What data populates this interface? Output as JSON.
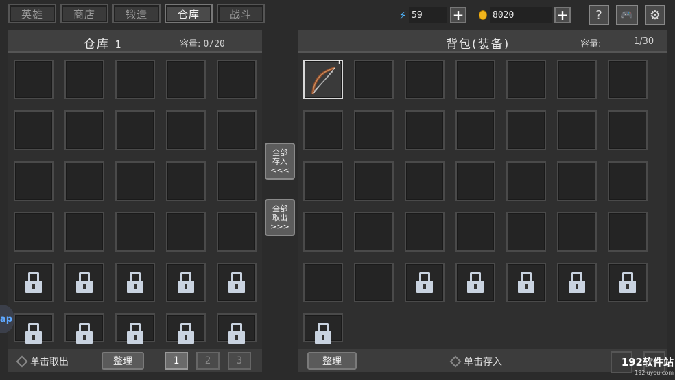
{
  "tabs": [
    "英雄",
    "商店",
    "锻造",
    "仓库",
    "战斗"
  ],
  "active_tab": 3,
  "resources": {
    "energy": "59",
    "gold": "8020"
  },
  "colors": {
    "energy": "#4fb6ff",
    "gold": "#f2b51c",
    "lock": "#c9d3e0"
  },
  "system_buttons": {
    "help": "?",
    "controller": "🎮",
    "settings": "⚙"
  },
  "storage": {
    "title": "仓库",
    "number": "1",
    "capacity_label": "容量:",
    "capacity": "0/20",
    "footer": {
      "hint": "单击取出",
      "sort": "整理",
      "pages": [
        "1",
        "2",
        "3"
      ],
      "active_page": 0
    }
  },
  "transfer": {
    "store_all": [
      "全部",
      "存入",
      "<<<"
    ],
    "take_all": [
      "全部",
      "取出",
      ">>>"
    ]
  },
  "backpack": {
    "title": "背包(装备)",
    "capacity_label": "容量:",
    "capacity": "1/30",
    "items": [
      {
        "slot": 0,
        "name": "bow",
        "count": "1"
      }
    ],
    "footer": {
      "sort": "整理",
      "hint": "单击存入"
    }
  },
  "side_tag": "ap",
  "watermark": {
    "main": "192软件站",
    "sub": "192luyou.com"
  }
}
